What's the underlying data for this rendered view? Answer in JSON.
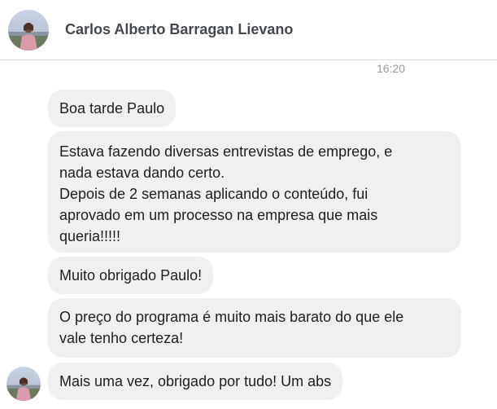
{
  "contact": {
    "name": "Carlos Alberto Barragan Lievano",
    "avatar_icon": "profile-photo-avatar"
  },
  "timestamp": "16:20",
  "messages": [
    {
      "lines": [
        "Boa tarde Paulo"
      ]
    },
    {
      "lines": [
        "Estava fazendo diversas entrevistas de emprego, e",
        "nada estava dando certo.",
        "Depois de 2 semanas aplicando o conteúdo, fui",
        "aprovado em um processo na empresa que mais",
        "queria!!!!!"
      ]
    },
    {
      "lines": [
        "Muito obrigado Paulo!"
      ]
    },
    {
      "lines": [
        "O preço do programa é muito mais barato do que ele",
        "vale tenho certeza!"
      ]
    },
    {
      "lines": [
        "Mais uma vez, obrigado por tudo! Um abs"
      ]
    }
  ],
  "colors": {
    "bubble_background": "#f1f0f0",
    "name_text": "#444950",
    "timestamp_text": "#999999",
    "divider": "#dddfe2"
  }
}
